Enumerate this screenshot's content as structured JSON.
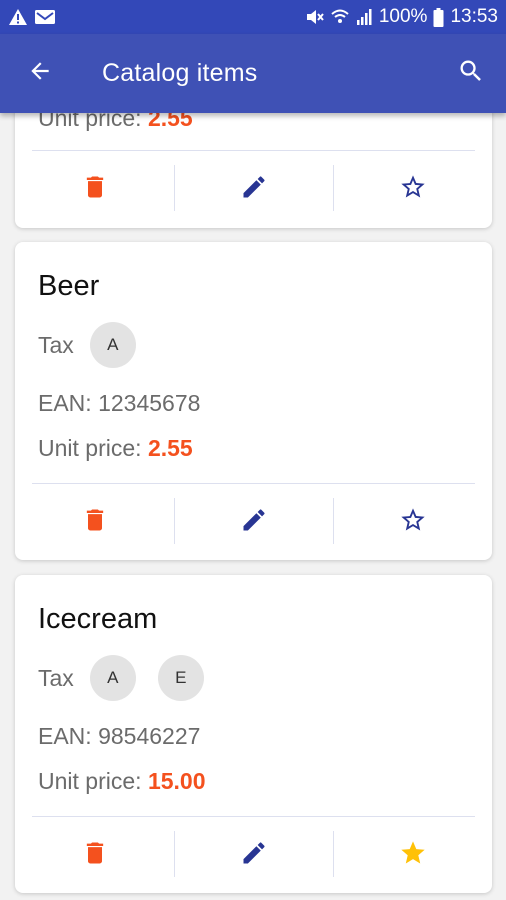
{
  "status_bar": {
    "battery": "100%",
    "time": "13:53"
  },
  "app_bar": {
    "title": "Catalog items"
  },
  "labels": {
    "tax": "Tax",
    "ean_prefix": "EAN: ",
    "unit_price_prefix": "Unit price: "
  },
  "items": [
    {
      "name": "",
      "taxes": [],
      "ean": "",
      "unit_price": "2.55",
      "favorite": false
    },
    {
      "name": "Beer",
      "taxes": [
        "A"
      ],
      "ean": "12345678",
      "unit_price": "2.55",
      "favorite": false
    },
    {
      "name": "Icecream",
      "taxes": [
        "A",
        "E"
      ],
      "ean": "98546227",
      "unit_price": "15.00",
      "favorite": true
    }
  ],
  "colors": {
    "app_bar": "#3f51b5",
    "status_bar": "#3348b8",
    "price": "#f4511e",
    "delete_icon": "#f4511e",
    "edit_icon": "#283593",
    "star_outline": "#283593",
    "star_filled": "#ffc107"
  },
  "icons": {
    "back": "arrow-back-icon",
    "search": "search-icon",
    "delete": "delete-icon",
    "edit": "edit-icon",
    "favorite": "star-icon"
  }
}
